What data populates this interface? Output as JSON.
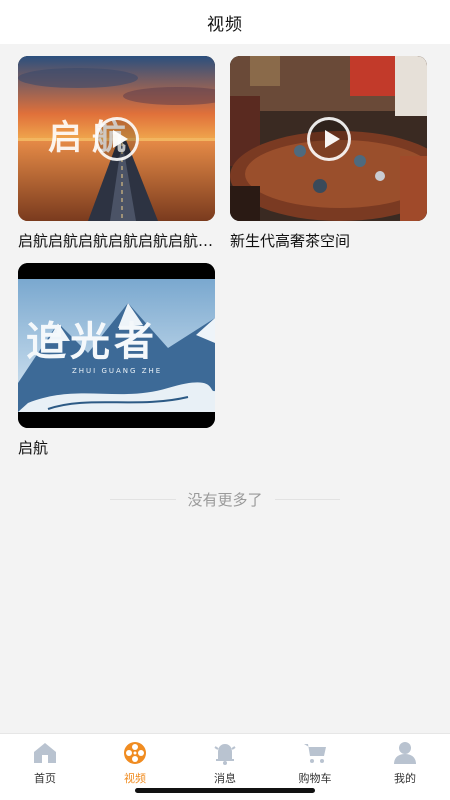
{
  "header": {
    "title": "视频"
  },
  "videos": [
    {
      "title": "启航启航启航启航启航启航启航",
      "thumb_text": "启航"
    },
    {
      "title": "新生代高奢茶空间"
    },
    {
      "title": "启航",
      "thumb_text": "追光者",
      "thumb_subtext": "ZHUI GUANG ZHE"
    }
  ],
  "footer": {
    "no_more": "没有更多了"
  },
  "tabbar": {
    "active_color": "#f08c21",
    "inactive_color": "#b9c3d0",
    "tabs": [
      {
        "label": "首页",
        "icon": "home-icon"
      },
      {
        "label": "视频",
        "icon": "film-reel-icon",
        "active": true
      },
      {
        "label": "消息",
        "icon": "bell-icon"
      },
      {
        "label": "购物车",
        "icon": "cart-icon"
      },
      {
        "label": "我的",
        "icon": "user-icon"
      }
    ]
  }
}
